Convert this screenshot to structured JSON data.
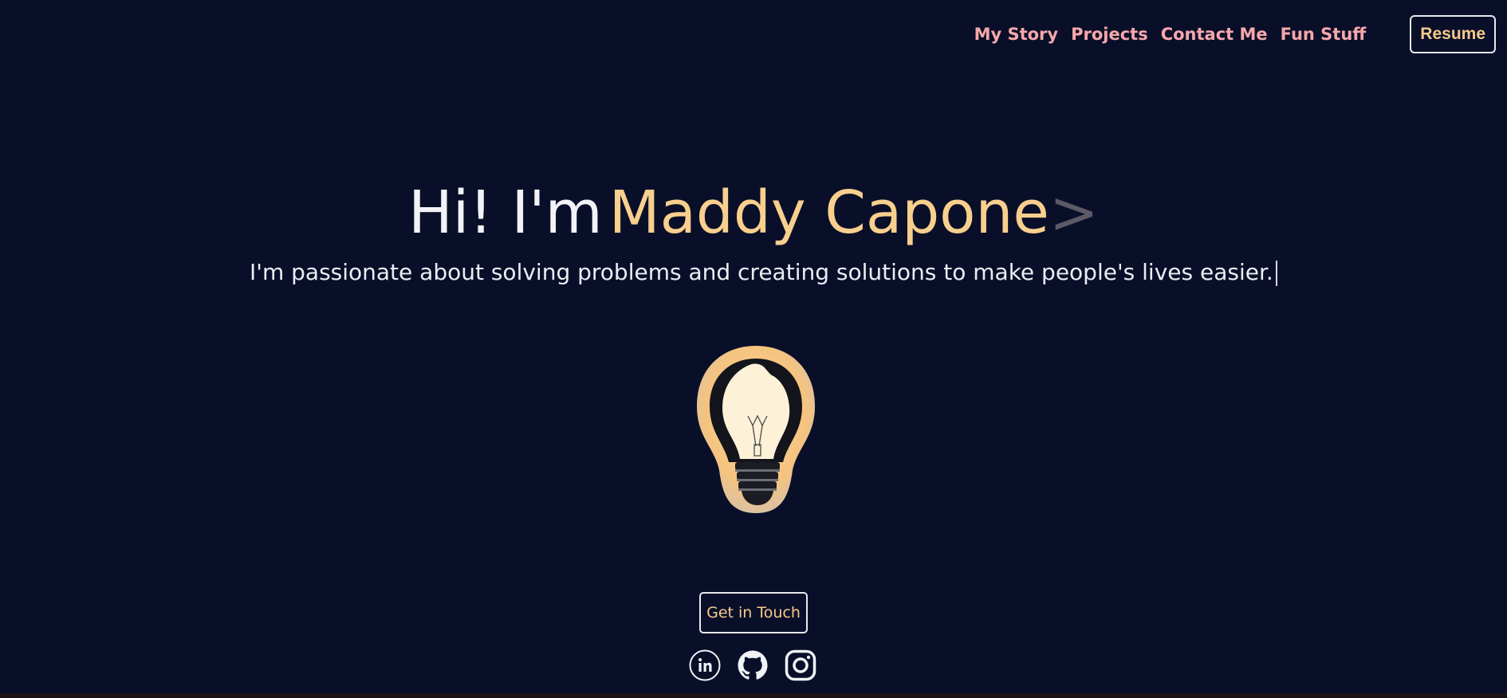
{
  "nav": {
    "links": [
      "My Story",
      "Projects",
      "Contact Me",
      "Fun Stuff"
    ],
    "resume_label": "Resume"
  },
  "hero": {
    "greeting": "Hi! I'm",
    "name": "Maddy Capone",
    "caret": ">",
    "subtitle": "I'm passionate about solving problems and creating solutions to make people's lives easier."
  },
  "cta": {
    "label": "Get in Touch"
  },
  "socials": [
    {
      "icon": "linkedin-icon"
    },
    {
      "icon": "github-icon"
    },
    {
      "icon": "instagram-icon"
    }
  ],
  "colors": {
    "background": "#0a0f29",
    "nav_link": "#f5a8ab",
    "accent": "#f8cf8d",
    "text": "#f2f3f7"
  }
}
